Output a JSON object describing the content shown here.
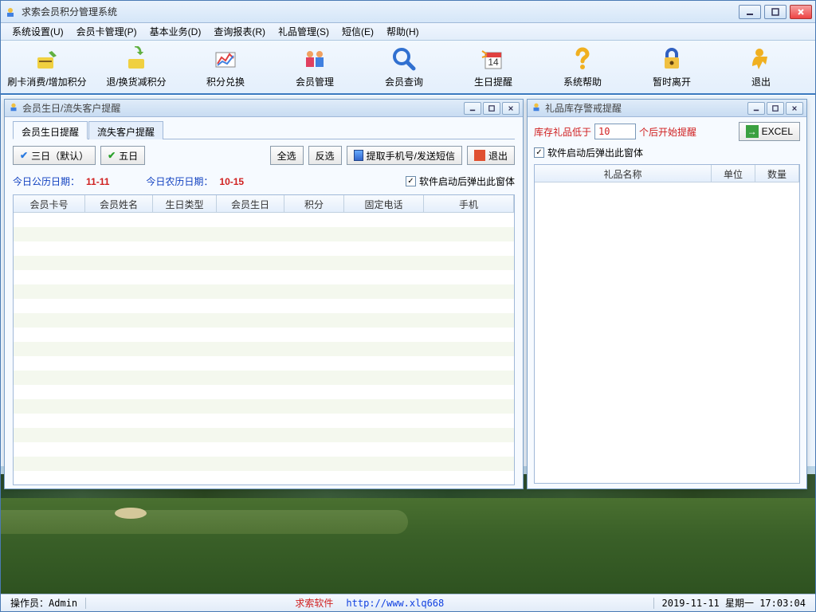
{
  "app": {
    "title": "求索会员积分管理系统"
  },
  "menu": {
    "items": [
      "系统设置(U)",
      "会员卡管理(P)",
      "基本业务(D)",
      "查询报表(R)",
      "礼品管理(S)",
      "短信(E)",
      "帮助(H)"
    ]
  },
  "toolbar": {
    "items": [
      {
        "label": "刷卡消费/增加积分",
        "icon": "card-swipe"
      },
      {
        "label": "退/换货减积分",
        "icon": "return-goods"
      },
      {
        "label": "积分兑换",
        "icon": "points-exchange"
      },
      {
        "label": "会员管理",
        "icon": "members"
      },
      {
        "label": "会员查询",
        "icon": "search"
      },
      {
        "label": "生日提醒",
        "icon": "birthday"
      },
      {
        "label": "系统帮助",
        "icon": "help"
      },
      {
        "label": "暂时离开",
        "icon": "lock"
      },
      {
        "label": "退出",
        "icon": "exit"
      }
    ]
  },
  "left_panel": {
    "title": "会员生日/流失客户提醒",
    "tabs": [
      "会员生日提醒",
      "流失客户提醒"
    ],
    "btn_three": "三日（默认）",
    "btn_five": "五日",
    "btn_select_all": "全选",
    "btn_invert": "反选",
    "btn_extract": "提取手机号/发送短信",
    "btn_exit": "退出",
    "gregorian_label": "今日公历日期：",
    "gregorian_value": "11-11",
    "lunar_label": "今日农历日期：",
    "lunar_value": "10-15",
    "checkbox_popup": "软件启动后弹出此窗体",
    "columns": [
      "会员卡号",
      "会员姓名",
      "生日类型",
      "会员生日",
      "积分",
      "固定电话",
      "手机"
    ]
  },
  "right_panel": {
    "title": "礼品库存警戒提醒",
    "prefix": "库存礼品低于",
    "threshold": "10",
    "suffix": "个后开始提醒",
    "btn_excel": "EXCEL",
    "checkbox_popup": "软件启动后弹出此窗体",
    "columns": [
      "礼品名称",
      "单位",
      "数量"
    ]
  },
  "status": {
    "operator_label": "操作员：",
    "operator_value": "Admin",
    "company": "求索软件",
    "url": "http://www.xlq668",
    "datetime": "2019-11-11  星期一  17:03:04"
  }
}
